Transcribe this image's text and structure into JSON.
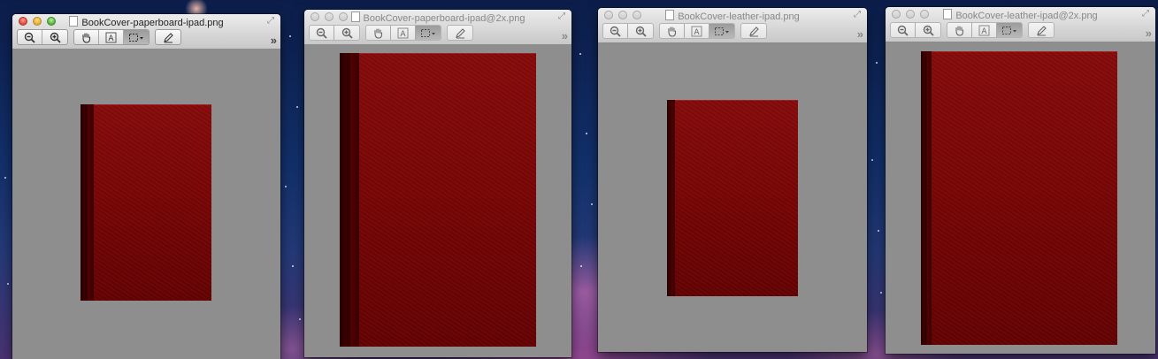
{
  "desktop": {
    "wallpaper": "galaxy"
  },
  "toolbar_icons": {
    "zoom_out": "zoom-out-icon",
    "zoom_in": "zoom-in-icon",
    "hand": "hand-tool-icon",
    "text": "text-select-icon",
    "select": "rect-select-icon",
    "annotate": "pencil-icon",
    "overflow": "»"
  },
  "windows": [
    {
      "title": "BookCover-paperboard-ipad.png",
      "active": true
    },
    {
      "title": "BookCover-paperboard-ipad@2x.png",
      "active": false
    },
    {
      "title": "BookCover-leather-ipad.png",
      "active": false
    },
    {
      "title": "BookCover-leather-ipad@2x.png",
      "active": false
    }
  ],
  "colors": {
    "cover_red": "#7a0606",
    "spine_dark": "#2a0000",
    "canvas_gray": "#8e8e8e"
  }
}
